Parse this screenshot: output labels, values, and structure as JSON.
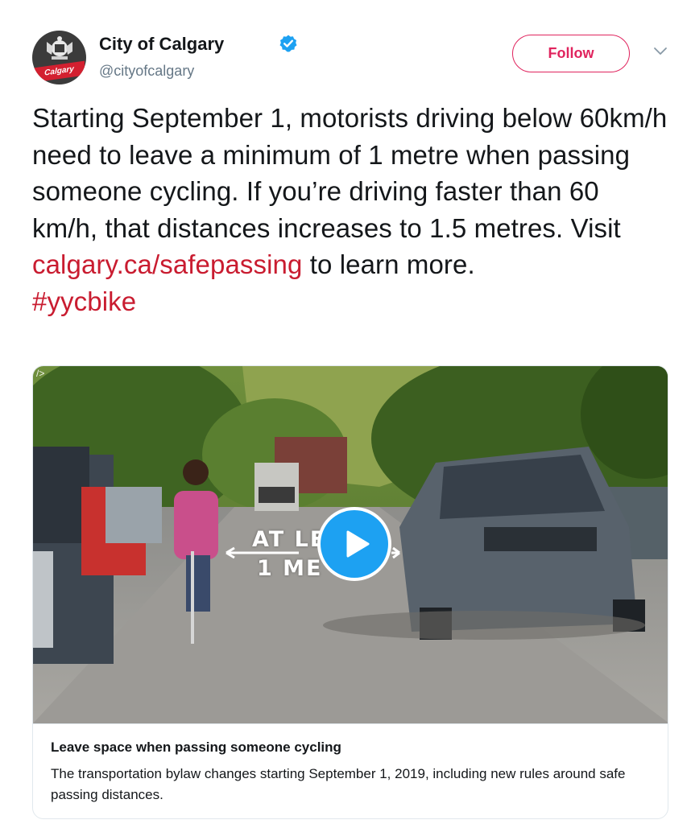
{
  "account": {
    "name": "City of Calgary",
    "handle": "@cityofcalgary",
    "avatar_banner": "Calgary",
    "verified_icon": "verified-badge-icon"
  },
  "actions": {
    "follow_label": "Follow",
    "more_icon": "chevron-down-icon"
  },
  "tweet": {
    "text_before_link": "Starting September 1, motorists driving below 60km/h need to leave a minimum of 1 metre when passing someone cycling. If you’re driving faster than 60 km/h, that distances increases to 1.5 metres. Visit ",
    "link": "calgary.ca/safepassing",
    "text_after_link": " to learn more.",
    "hashtag": "#yycbike"
  },
  "card": {
    "media_corner_mark": "/>",
    "overlay_line1": "AT LE",
    "overlay_line2": "1 ME",
    "play_icon": "play-icon",
    "title": "Leave space when passing someone cycling",
    "description": "The transportation bylaw changes starting September 1, 2019, including new rules around safe passing distances."
  },
  "colors": {
    "link": "#c91c30",
    "follow": "#e0245e",
    "play": "#1da1f2",
    "verified": "#1da1f2"
  }
}
